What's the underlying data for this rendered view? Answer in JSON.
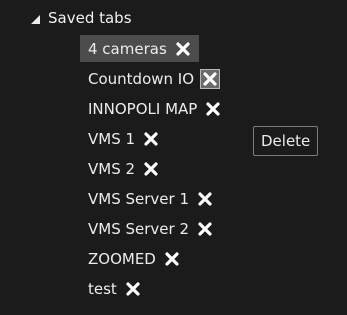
{
  "saved_tabs": {
    "header_label": "Saved tabs",
    "items": [
      {
        "label": "4 cameras",
        "selected": true
      },
      {
        "label": "Countdown IO",
        "delete_hovered": true
      },
      {
        "label": "INNOPOLI MAP"
      },
      {
        "label": "VMS 1"
      },
      {
        "label": "VMS 2"
      },
      {
        "label": "VMS Server 1"
      },
      {
        "label": "VMS Server 2"
      },
      {
        "label": "ZOOMED"
      },
      {
        "label": "test"
      }
    ]
  },
  "tooltip": {
    "text": "Delete"
  },
  "icons": {
    "collapse": "caret-down-icon",
    "delete": "close-icon"
  },
  "colors": {
    "panel_background": "#1b1b1b",
    "selected_background": "#4c4c4c",
    "text": "#ececec"
  }
}
